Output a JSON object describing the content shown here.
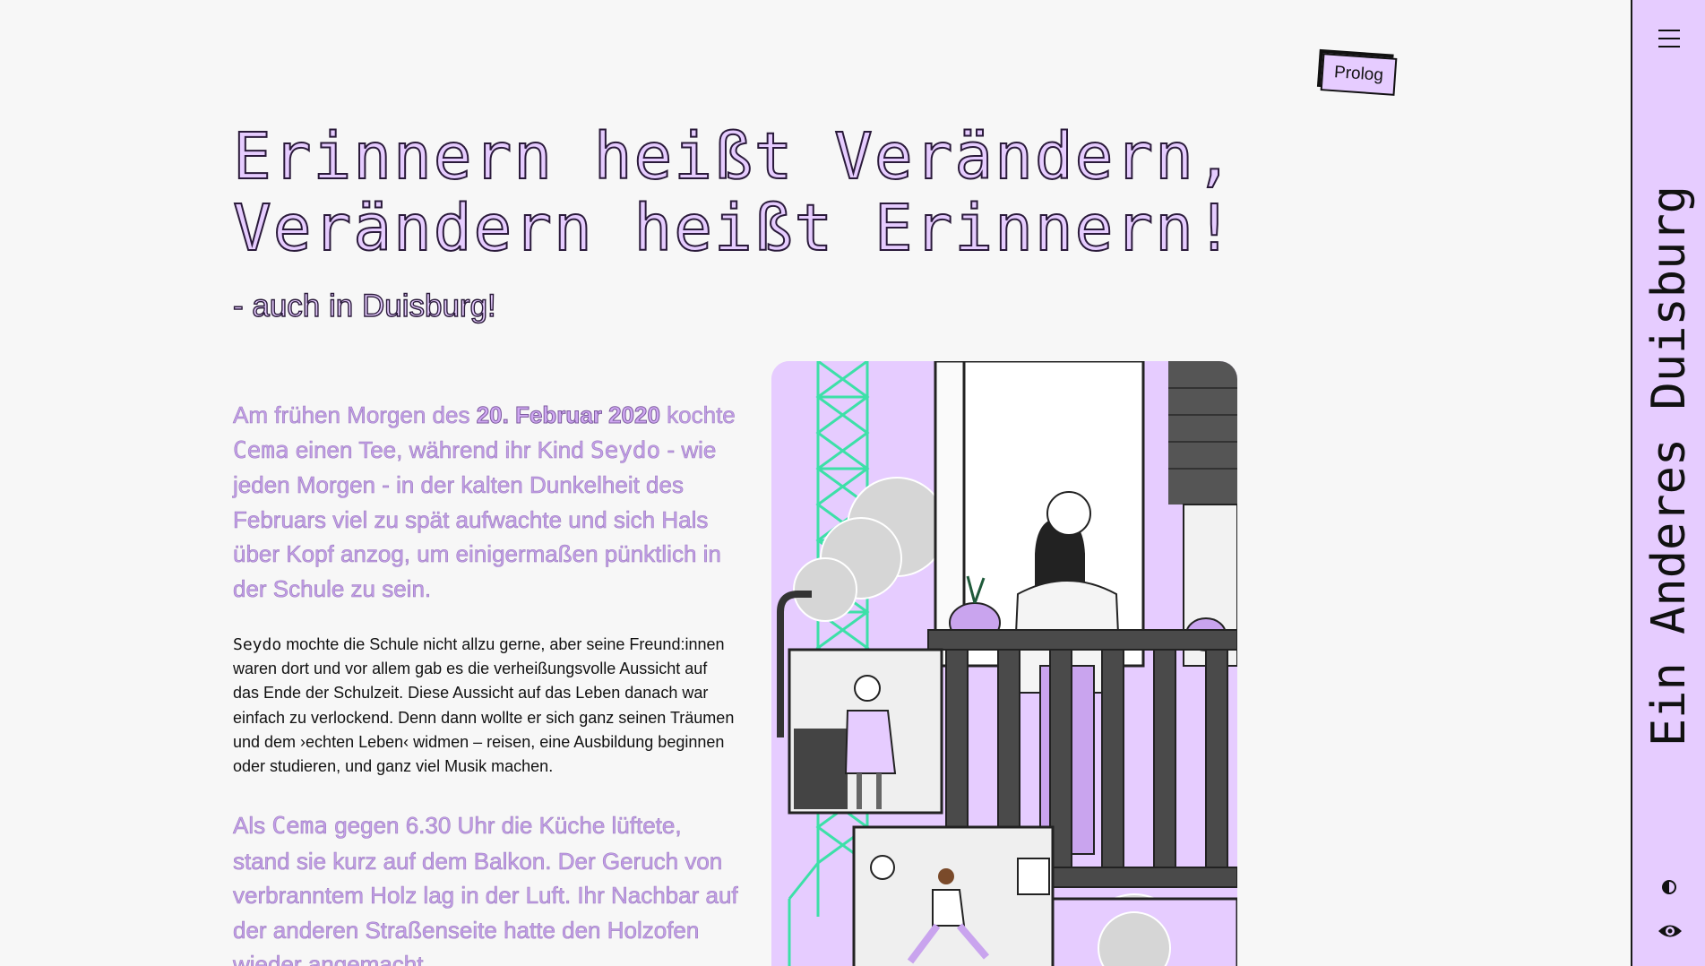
{
  "nav": {
    "prolog_label": "Prolog"
  },
  "sidebar": {
    "title": "Ein Anderes Duisburg"
  },
  "hero": {
    "headline_line1": "Erinnern heißt Verändern,",
    "headline_line2": "Verändern heißt Erinnern!",
    "subtitle": "- auch in Duisburg!"
  },
  "article": {
    "p1": {
      "t1": "Am frühen Morgen des ",
      "date": "20. Februar 2020",
      "t2": " kochte ",
      "name1": "Cema",
      "t3": " einen Tee, während ihr Kind ",
      "name2": "Seydo",
      "t4": " - wie jeden Morgen - in der kalten Dunkelheit des Februars viel zu spät aufwachte und sich Hals über Kopf anzog, um einigermaßen pünktlich in der Schule zu sein."
    },
    "p2": {
      "name": "Seydo",
      "text": " mochte die Schule nicht allzu gerne, aber seine Freund:innen waren dort und vor allem gab es die verheißungsvolle Aussicht auf das Ende der Schulzeit. Diese Aussicht auf das Leben danach war einfach zu verlockend. Denn dann wollte er sich ganz seinen Träumen und dem ›echten Leben‹ widmen – reisen, eine Ausbildung beginnen oder studieren, und ganz viel Musik machen."
    },
    "p3": {
      "t1": "Als ",
      "name": "Cema",
      "t2": " gegen 6.30 Uhr die Küche lüftete, stand sie kurz auf dem Balkon. Der Geruch von verbranntem Holz lag in der Luft. Ihr Nachbar auf der anderen Straßenseite hatte den Holzofen wieder angemacht."
    }
  },
  "colors": {
    "background": "#f7f7f7",
    "accent_lilac": "#e6ccff",
    "accent_green": "#3de0a8",
    "text_dark": "#111111"
  },
  "icons": {
    "menu": "hamburger-menu-icon",
    "contrast": "contrast-toggle-icon",
    "eye": "eye-icon"
  }
}
